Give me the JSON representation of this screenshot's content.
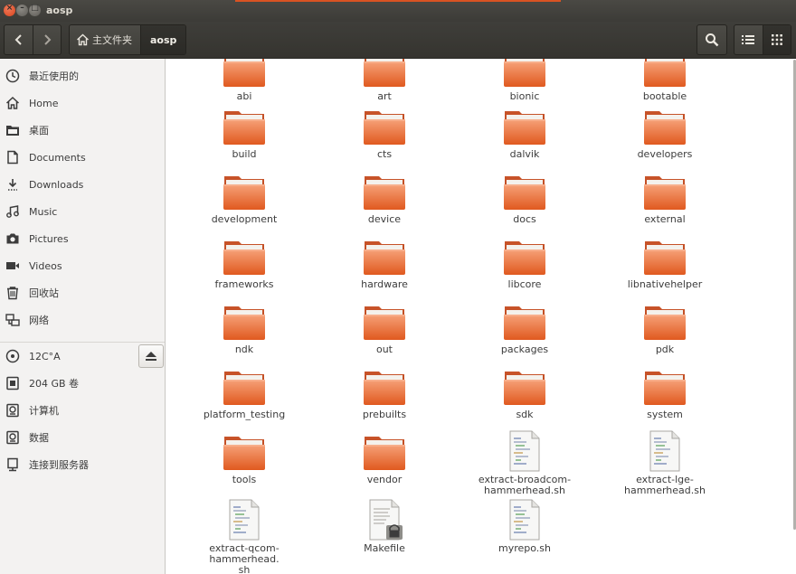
{
  "window": {
    "title": "aosp",
    "accent": "#e95420"
  },
  "toolbar": {
    "back_icon": "chevron-left-icon",
    "forward_icon": "chevron-right-icon",
    "breadcrumb": [
      {
        "label": "主文件夹",
        "icon": "home-icon"
      },
      {
        "label": "aosp"
      }
    ],
    "search_icon": "search-icon",
    "list_view_icon": "list-view-icon",
    "grid_view_icon": "grid-view-icon"
  },
  "sidebar": {
    "places": [
      {
        "label": "最近使用的",
        "icon": "clock-icon"
      },
      {
        "label": "Home",
        "icon": "home-icon"
      },
      {
        "label": "桌面",
        "icon": "desktop-folder-icon"
      },
      {
        "label": "Documents",
        "icon": "document-icon"
      },
      {
        "label": "Downloads",
        "icon": "download-icon"
      },
      {
        "label": "Music",
        "icon": "music-icon"
      },
      {
        "label": "Pictures",
        "icon": "camera-icon"
      },
      {
        "label": "Videos",
        "icon": "video-icon"
      },
      {
        "label": "回收站",
        "icon": "trash-icon"
      },
      {
        "label": "网络",
        "icon": "network-icon"
      }
    ],
    "devices": [
      {
        "label": "12C°A",
        "icon": "optical-disc-icon"
      },
      {
        "label": "204 GB 卷",
        "icon": "drive-icon"
      },
      {
        "label": "计算机",
        "icon": "computer-drive-icon"
      },
      {
        "label": "数据",
        "icon": "drive-icon"
      },
      {
        "label": "连接到服务器",
        "icon": "server-icon"
      }
    ],
    "eject_icon": "eject-icon"
  },
  "files": [
    {
      "name": "abi",
      "type": "folder"
    },
    {
      "name": "art",
      "type": "folder"
    },
    {
      "name": "bionic",
      "type": "folder"
    },
    {
      "name": "bootable",
      "type": "folder"
    },
    {
      "name": "build",
      "type": "folder"
    },
    {
      "name": "cts",
      "type": "folder"
    },
    {
      "name": "dalvik",
      "type": "folder"
    },
    {
      "name": "developers",
      "type": "folder"
    },
    {
      "name": "development",
      "type": "folder"
    },
    {
      "name": "device",
      "type": "folder"
    },
    {
      "name": "docs",
      "type": "folder"
    },
    {
      "name": "external",
      "type": "folder"
    },
    {
      "name": "frameworks",
      "type": "folder"
    },
    {
      "name": "hardware",
      "type": "folder"
    },
    {
      "name": "libcore",
      "type": "folder"
    },
    {
      "name": "libnativehelper",
      "type": "folder"
    },
    {
      "name": "ndk",
      "type": "folder"
    },
    {
      "name": "out",
      "type": "folder"
    },
    {
      "name": "packages",
      "type": "folder"
    },
    {
      "name": "pdk",
      "type": "folder"
    },
    {
      "name": "platform_testing",
      "type": "folder"
    },
    {
      "name": "prebuilts",
      "type": "folder"
    },
    {
      "name": "sdk",
      "type": "folder"
    },
    {
      "name": "system",
      "type": "folder"
    },
    {
      "name": "tools",
      "type": "folder"
    },
    {
      "name": "vendor",
      "type": "folder"
    },
    {
      "name": "extract-broadcom-hammerhead.sh",
      "type": "script"
    },
    {
      "name": "extract-lge-hammerhead.sh",
      "type": "script"
    },
    {
      "name": "extract-qcom-hammerhead.sh",
      "type": "script"
    },
    {
      "name": "Makefile",
      "type": "locked-text"
    },
    {
      "name": "myrepo.sh",
      "type": "script"
    }
  ],
  "labels_wrapped": {
    "extract-broadcom-hammerhead.sh": [
      "extract-broadcom-",
      "hammerhead.sh"
    ],
    "extract-qcom-hammerhead.sh": [
      "extract-qcom-hammerhead.",
      "sh"
    ]
  }
}
